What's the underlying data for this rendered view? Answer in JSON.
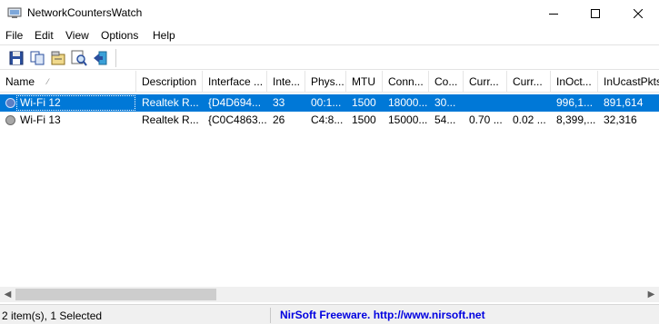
{
  "window": {
    "title": "NetworkCountersWatch",
    "minimize_symbol": "—",
    "maximize_symbol": "☐",
    "close_symbol": "✕"
  },
  "menu": [
    "File",
    "Edit",
    "View",
    "Options",
    "Help"
  ],
  "toolbar": {
    "buttons": [
      "save-icon",
      "copy-icon",
      "properties-icon",
      "find-icon",
      "exit-icon"
    ]
  },
  "columns": [
    "Name",
    "Description",
    "Interface ...",
    "Inte...",
    "Phys...",
    "MTU",
    "Conn...",
    "Co...",
    "Curr...",
    "Curr...",
    "InOct...",
    "InUcastPkts"
  ],
  "sort_indicator": "⁄",
  "rows": [
    {
      "selected": true,
      "status_color": "#5b7fc4",
      "cells": [
        "Wi-Fi 12",
        "Realtek R...",
        "{D4D694...",
        "33",
        "00:1...",
        "1500",
        "18000...",
        "30...",
        "",
        "",
        "996,1...",
        "891,614"
      ]
    },
    {
      "selected": false,
      "status_color": "#a8a8a8",
      "cells": [
        "Wi-Fi 13",
        "Realtek R...",
        "{C0C4863...",
        "26",
        "C4:8...",
        "1500",
        "15000...",
        "54...",
        "0.70 ...",
        "0.02 ...",
        "8,399,...",
        "32,316"
      ]
    }
  ],
  "scrollbar": {
    "left_arrow": "◀",
    "right_arrow": "▶"
  },
  "status": {
    "items": "2 item(s), 1 Selected",
    "link": "NirSoft Freeware.  http://www.nirsoft.net"
  },
  "colors": {
    "selection": "#0078d7",
    "link": "#0000e0"
  }
}
